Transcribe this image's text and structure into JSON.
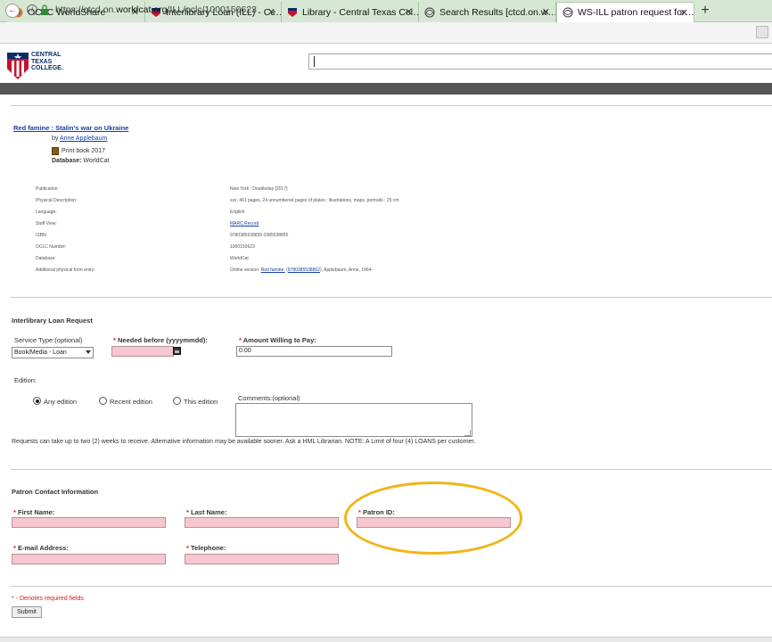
{
  "browser": {
    "tabs": [
      {
        "title": "OCLC WorldShare",
        "icon": "oclc-icon"
      },
      {
        "title": "Interlibrary Loan (ILL) - Ce…",
        "icon": "ctc-icon"
      },
      {
        "title": "Library - Central Texas Col…",
        "icon": "ctc-icon"
      },
      {
        "title": "Search Results [ctcd.on.w…",
        "icon": "worldcat-icon"
      },
      {
        "title": "WS-ILL patron request for…",
        "icon": "worldcat-icon"
      }
    ],
    "active_tab": 4,
    "close_glyph": "✕",
    "new_tab_glyph": "+",
    "url_prefix": "https://ctcd.on.",
    "url_domain": "worldcat.org",
    "url_path": "/ILL/oclc/1000150623"
  },
  "header": {
    "logo_line1": "CENTRAL",
    "logo_line2": "TEXAS",
    "logo_line3": "COLLEGE.",
    "colors": {
      "navy": "#0b2b6b",
      "red": "#c8102e",
      "dark_band": "#555555"
    }
  },
  "record": {
    "title": "Red famine : Stalin's war on Ukraine",
    "by_prefix": "by",
    "author": "Anne Applebaum",
    "format": "Print book 2017",
    "database_label": "Database:",
    "database_value": "WorldCat",
    "details": [
      {
        "label": "Publication:",
        "value": "New York : Doubleday [2017]"
      },
      {
        "label": "Physical Description:",
        "value": "xxx, 461 pages, 24 unnumbered pages of plates : illustrations, maps, portraits ; 25 cm"
      },
      {
        "label": "Language:",
        "value": "English"
      },
      {
        "label": "Staff View:",
        "value": "MARC Record"
      },
      {
        "label": "ISBN:",
        "value": "9780385538855 0385538855"
      },
      {
        "label": "OCLC Number:",
        "value": "1000150623"
      },
      {
        "label": "Database:",
        "value": "WorldCat"
      },
      {
        "label": "Additional physical form entry:",
        "value_pre": "Online version:",
        "value_link1": "Red famine.",
        "value_mid": "(",
        "value_link2": "9780385538862",
        "value_post": "), Applebaum, Anne, 1964-"
      }
    ]
  },
  "ill_form": {
    "heading": "Interlibrary Loan Request",
    "service_type_label": "Service Type:(optional)",
    "service_type_value": "Book/Media - Loan",
    "needed_before_label": "Needed before (yyyymmdd):",
    "amount_label": "Amount Willing to Pay:",
    "amount_value": "0.00",
    "edition_label": "Edition:",
    "edition_options": [
      "Any edition",
      "Recent edition",
      "This edition"
    ],
    "edition_selected": 0,
    "comments_label": "Comments:(optional)",
    "note": "Requests can take up to two (2) weeks to receive. Alternative information may be available sooner. Ask a HML Librarian. NOTE: A Limit of four (4) LOANS per customer."
  },
  "patron": {
    "heading": "Patron Contact Information",
    "first_name_label": "First Name:",
    "last_name_label": "Last Name:",
    "patron_id_label": "Patron ID:",
    "email_label": "E-mail Address:",
    "telephone_label": "Telephone:",
    "required_star": "*"
  },
  "footer": {
    "required_note": "* - Denotes required fields",
    "submit_label": "Submit"
  }
}
